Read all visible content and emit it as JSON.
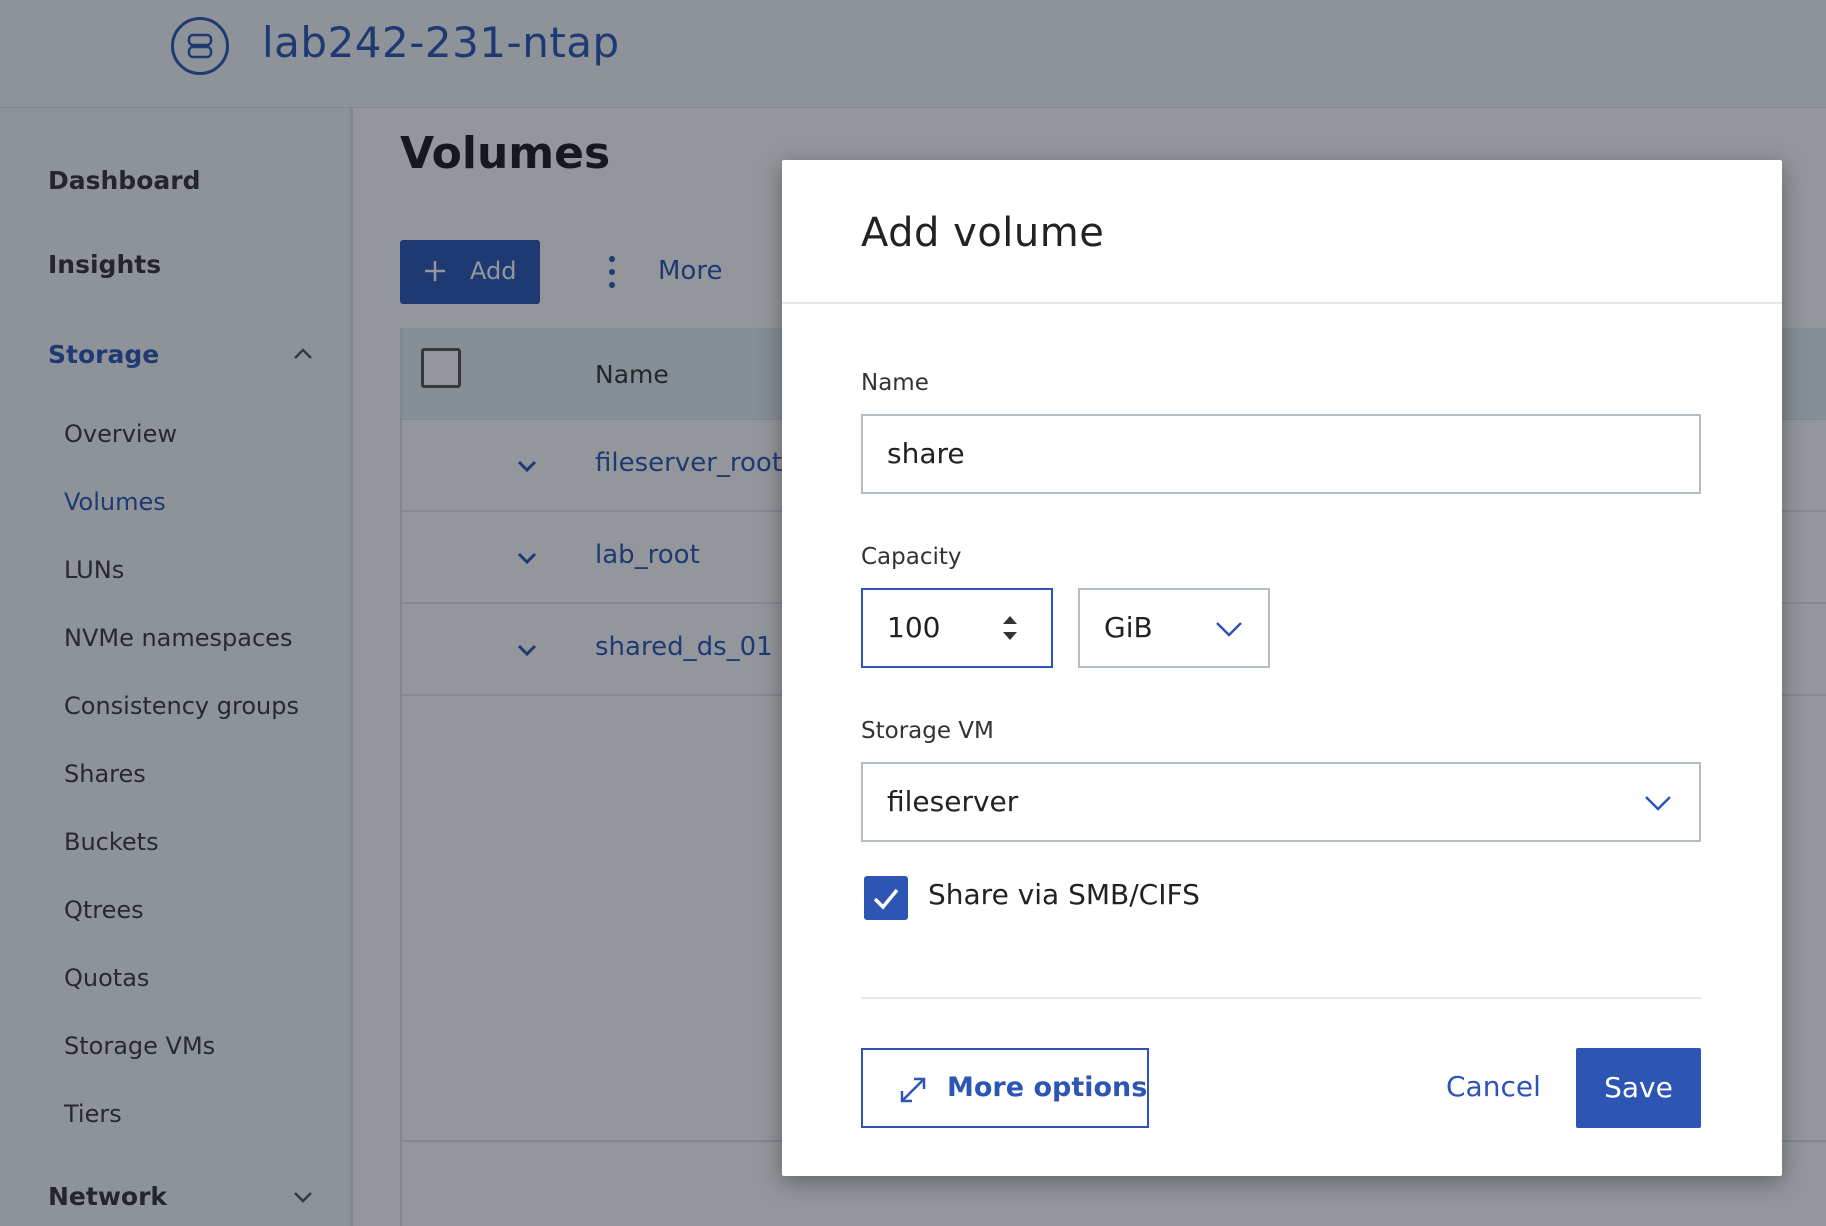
{
  "header": {
    "cluster_name": "lab242-231-ntap",
    "cluster_icon": "storage-cluster-icon"
  },
  "sidebar": {
    "dashboard": "Dashboard",
    "insights": "Insights",
    "storage": "Storage",
    "storage_items": [
      "Overview",
      "Volumes",
      "LUNs",
      "NVMe namespaces",
      "Consistency groups",
      "Shares",
      "Buckets",
      "Qtrees",
      "Quotas",
      "Storage VMs",
      "Tiers"
    ],
    "active_item": "Volumes",
    "network": "Network"
  },
  "main": {
    "title": "Volumes",
    "toolbar": {
      "add_label": "Add",
      "more_label": "More"
    },
    "table": {
      "header_name": "Name",
      "rows": [
        "fileserver_root",
        "lab_root",
        "shared_ds_01"
      ]
    }
  },
  "dialog": {
    "title": "Add volume",
    "name_label": "Name",
    "name_value": "share",
    "capacity_label": "Capacity",
    "capacity_value": "100",
    "capacity_unit": "GiB",
    "svm_label": "Storage VM",
    "svm_value": "fileserver",
    "smb_checked": true,
    "smb_label": "Share via SMB/CIFS",
    "more_options": "More options",
    "cancel": "Cancel",
    "save": "Save"
  },
  "colors": {
    "accent": "#2d55b4",
    "overlay": "rgba(15,25,35,0.45)"
  }
}
